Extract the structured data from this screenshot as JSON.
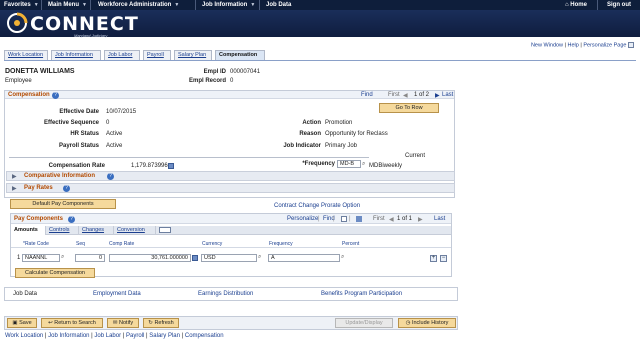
{
  "topnav": {
    "favorites": "Favorites",
    "main_menu": "Main Menu",
    "workforce": "Workforce Administration",
    "job_info": "Job Information",
    "job_data": "Job Data",
    "home": "Home",
    "signout": "Sign out"
  },
  "banner": {
    "logo": "CONNECT",
    "sub": "Maryland Judiciary"
  },
  "toplinks": {
    "new_window": "New Window",
    "help": "Help",
    "personalize": "Personalize Page"
  },
  "tabs": [
    "Work Location",
    "Job Information",
    "Job Labor",
    "Payroll",
    "Salary Plan",
    "Compensation"
  ],
  "employee": {
    "name": "DONETTA WILLIAMS",
    "role": "Employee",
    "empl_id_label": "Empl ID",
    "empl_id": "000007041",
    "empl_record_label": "Empl Record",
    "empl_record": "0"
  },
  "compensation": {
    "title": "Compensation",
    "find": "Find",
    "first": "First",
    "pager": "1 of 2",
    "last": "Last",
    "goto": "Go To Row",
    "effective_date_label": "Effective Date",
    "effective_date": "10/07/2015",
    "effective_seq_label": "Effective Sequence",
    "effective_seq": "0",
    "action_label": "Action",
    "action": "Promotion",
    "hr_status_label": "HR Status",
    "hr_status": "Active",
    "reason_label": "Reason",
    "reason": "Opportunity for Reclass",
    "payroll_status_label": "Payroll Status",
    "payroll_status": "Active",
    "job_indicator_label": "Job Indicator",
    "job_indicator": "Primary Job",
    "current": "Current",
    "comp_rate_label": "Compensation Rate",
    "comp_rate": "1,179.873996",
    "frequency_label": "*Frequency",
    "frequency": "MD-B",
    "frequency_desc": "MDBiweekly",
    "comparative": "Comparative Information",
    "pay_rates": "Pay Rates",
    "default_btn": "Default Pay Components",
    "contract_link": "Contract Change Prorate Option"
  },
  "pay_components": {
    "title": "Pay Components",
    "personalize": "Personalize",
    "find": "Find",
    "first": "First",
    "pager": "1 of 1",
    "last": "Last",
    "grid_tabs": [
      "Amounts",
      "Controls",
      "Changes",
      "Conversion"
    ],
    "columns": [
      "*Rate Code",
      "Seq",
      "Comp Rate",
      "Currency",
      "Frequency",
      "Percent"
    ],
    "row": {
      "num": "1",
      "rate_code": "NAANNL",
      "seq": "0",
      "comp_rate": "30,761.000000",
      "currency": "USD",
      "frequency": "A"
    },
    "calc_btn": "Calculate Compensation"
  },
  "bottom_links": [
    "Job Data",
    "Employment Data",
    "Earnings Distribution",
    "Benefits Program Participation"
  ],
  "toolbar": {
    "save": "Save",
    "return": "Return to Search",
    "notify": "Notify",
    "refresh": "Refresh",
    "update": "Update/Display",
    "include": "Include History"
  },
  "footer_links": [
    "Work Location",
    "Job Information",
    "Job Labor",
    "Payroll",
    "Salary Plan",
    "Compensation"
  ]
}
